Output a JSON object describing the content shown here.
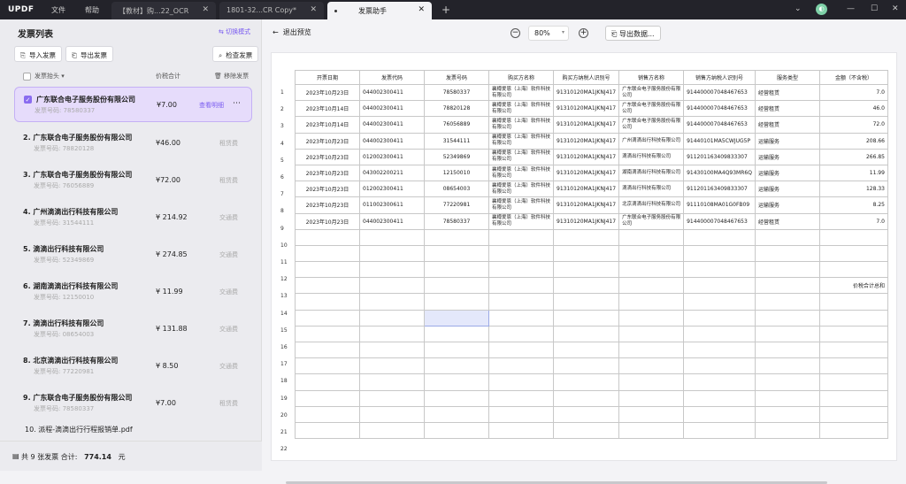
{
  "app": {
    "logo": "UPDF",
    "menu": [
      "文件",
      "帮助"
    ]
  },
  "tabs": [
    {
      "label": "【教材】购...22_OCR"
    },
    {
      "label": "1801-32...CR Copy*"
    },
    {
      "label": "发票助手"
    }
  ],
  "sidebar": {
    "title": "发票列表",
    "switch": "切换模式",
    "buttons": {
      "import": "导入发票",
      "export": "导出发票",
      "check": "检查发票"
    },
    "header": {
      "col1": "发票抬头",
      "col2": "价税合计",
      "col3": "移除发票"
    },
    "code_label": "发票号码:",
    "items": [
      {
        "name": "广东联合电子服务股份有限公司",
        "code": "78580337",
        "price": "¥7.00",
        "cat": "查看明细"
      },
      {
        "name": "2. 广东联合电子服务股份有限公司",
        "code": "78820128",
        "price": "¥46.00",
        "cat": "租赁费"
      },
      {
        "name": "3. 广东联合电子服务股份有限公司",
        "code": "76056889",
        "price": "¥72.00",
        "cat": "租赁费"
      },
      {
        "name": "4. 广州滴滴出行科技有限公司",
        "code": "31544111",
        "price": "¥ 214.92",
        "cat": "交通费"
      },
      {
        "name": "5. 滴滴出行科技有限公司",
        "code": "52349869",
        "price": "¥ 274.85",
        "cat": "交通费"
      },
      {
        "name": "6. 湖南滴滴出行科技有限公司",
        "code": "12150010",
        "price": "¥ 11.99",
        "cat": "交通费"
      },
      {
        "name": "7. 滴滴出行科技有限公司",
        "code": "08654003",
        "price": "¥ 131.88",
        "cat": "交通费"
      },
      {
        "name": "8. 北京滴滴出行科技有限公司",
        "code": "77220981",
        "price": "¥ 8.50",
        "cat": "交通费"
      },
      {
        "name": "9. 广东联合电子服务股份有限公司",
        "code": "78580337",
        "price": "¥7.00",
        "cat": "租赁费"
      },
      {
        "name": "10. 派程-滴滴出行行程报销单.pdf",
        "code": "",
        "price": "",
        "cat": ""
      }
    ],
    "footer": {
      "count": "共 9 张发票 合计:",
      "total": "774.14",
      "unit": "元"
    }
  },
  "main": {
    "back": "退出预览",
    "zoom": "80%",
    "export": "导出数据...",
    "columns": [
      "开票日期",
      "发票代码",
      "发票号码",
      "购买方名称",
      "购买方纳税人识别号",
      "销售方名称",
      "销售方纳税人识别号",
      "服务类型",
      "金额（不含税）"
    ],
    "rows": [
      [
        "2023年10月23日",
        "044002300411",
        "78580337",
        "襄樽爱恩（上海）软件科技有限公司",
        "91310120MA1JKNJ417",
        "广东联合电子服务股份有限公司",
        "91440000704846765​3",
        "经营租赁",
        "7.0"
      ],
      [
        "2023年10月14日",
        "044002300411",
        "78820128",
        "襄樽爱恩（上海）软件科技有限公司",
        "91310120MA1JKNJ417",
        "广东联合电子服务股份有限公司",
        "91440000704846765​3",
        "经营租赁",
        "46.0"
      ],
      [
        "2023年10月14日",
        "044002300411",
        "76056889",
        "襄樽爱恩（上海）软件科技有限公司",
        "91310120MA1JKNJ417",
        "广东联合电子服务股份有限公司",
        "91440000704846765​3",
        "经营租赁",
        "72.0"
      ],
      [
        "2023年10月23日",
        "044002300411",
        "31544111",
        "襄樽爱恩（上海）软件科技有限公司",
        "91310120MA1JKNJ417",
        "广州滴滴出行科技有限公司",
        "91440101MA5CWJUG5P",
        "运输服务",
        "208.66"
      ],
      [
        "2023年10月23日",
        "012002300411",
        "52349869",
        "襄樽爱恩（上海）软件科技有限公司",
        "91310120MA1JKNJ417",
        "滴滴出行科技有限公司",
        "911201163409833307",
        "运输服务",
        "266.85"
      ],
      [
        "2023年10月23日",
        "043002200211",
        "12150010",
        "襄樽爱恩（上海）软件科技有限公司",
        "91310120MA1JKNJ417",
        "湖南滴滴出行科技有限公司",
        "91430100MA4Q93MR6Q",
        "运输服务",
        "11.99"
      ],
      [
        "2023年10月23日",
        "012002300411",
        "08654003",
        "襄樽爱恩（上海）软件科技有限公司",
        "91310120MA1JKNJ417",
        "滴滴出行科技有限公司",
        "911201163409833307",
        "运输服务",
        "128.33"
      ],
      [
        "2023年10月23日",
        "011002300611",
        "77220981",
        "襄樽爱恩（上海）软件科技有限公司",
        "91310120MA1JKNJ417",
        "北京滴滴出行科技有限公司",
        "91110108MA01G0FB09",
        "运输服务",
        "8.25"
      ],
      [
        "2023年10月23日",
        "044002300411",
        "78580337",
        "襄樽爱恩（上海）软件科技有限公司",
        "91310120MA1JKNJ417",
        "广东联合电子服务股份有限公司",
        "91440000704846765​3",
        "经营租赁",
        "7.0"
      ]
    ],
    "total_label": "价税合计总和"
  }
}
